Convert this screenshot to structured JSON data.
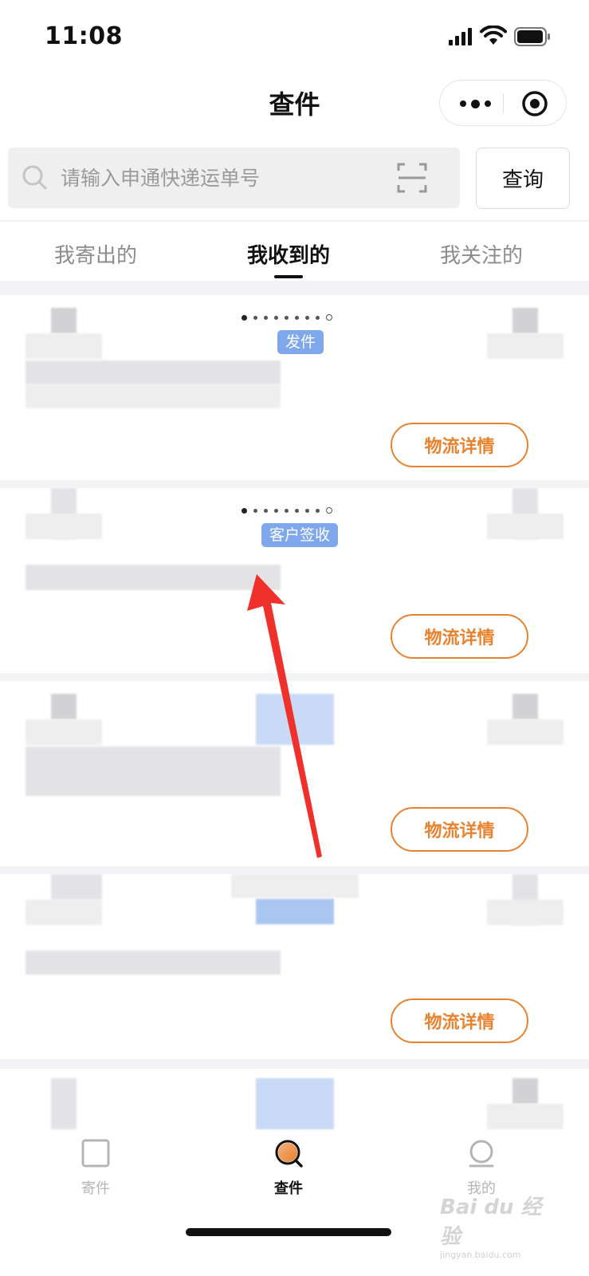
{
  "status_bar": {
    "time": "11:08"
  },
  "nav": {
    "title": "查件"
  },
  "search": {
    "placeholder": "请输入申通快递运单号",
    "button_label": "查询"
  },
  "tabs": [
    {
      "label": "我寄出的",
      "active": false
    },
    {
      "label": "我收到的",
      "active": true
    },
    {
      "label": "我关注的",
      "active": false
    }
  ],
  "cards": [
    {
      "status": "发件",
      "detail_label": "物流详情"
    },
    {
      "status": "客户签收",
      "detail_label": "物流详情"
    },
    {
      "detail_label": "物流详情"
    },
    {
      "detail_label": "物流详情"
    }
  ],
  "tabbar": [
    {
      "label": "寄件",
      "icon": "box-icon",
      "active": false
    },
    {
      "label": "查件",
      "icon": "search-package-icon",
      "active": true
    },
    {
      "label": "我的",
      "icon": "profile-icon",
      "active": false
    }
  ],
  "watermark": {
    "text": "Bai du 经验",
    "sub": "jingyan.baidu.com"
  },
  "colors": {
    "accent_orange": "#e8822e",
    "badge_blue": "#7fa8ec",
    "arrow_red": "#f0302a"
  }
}
